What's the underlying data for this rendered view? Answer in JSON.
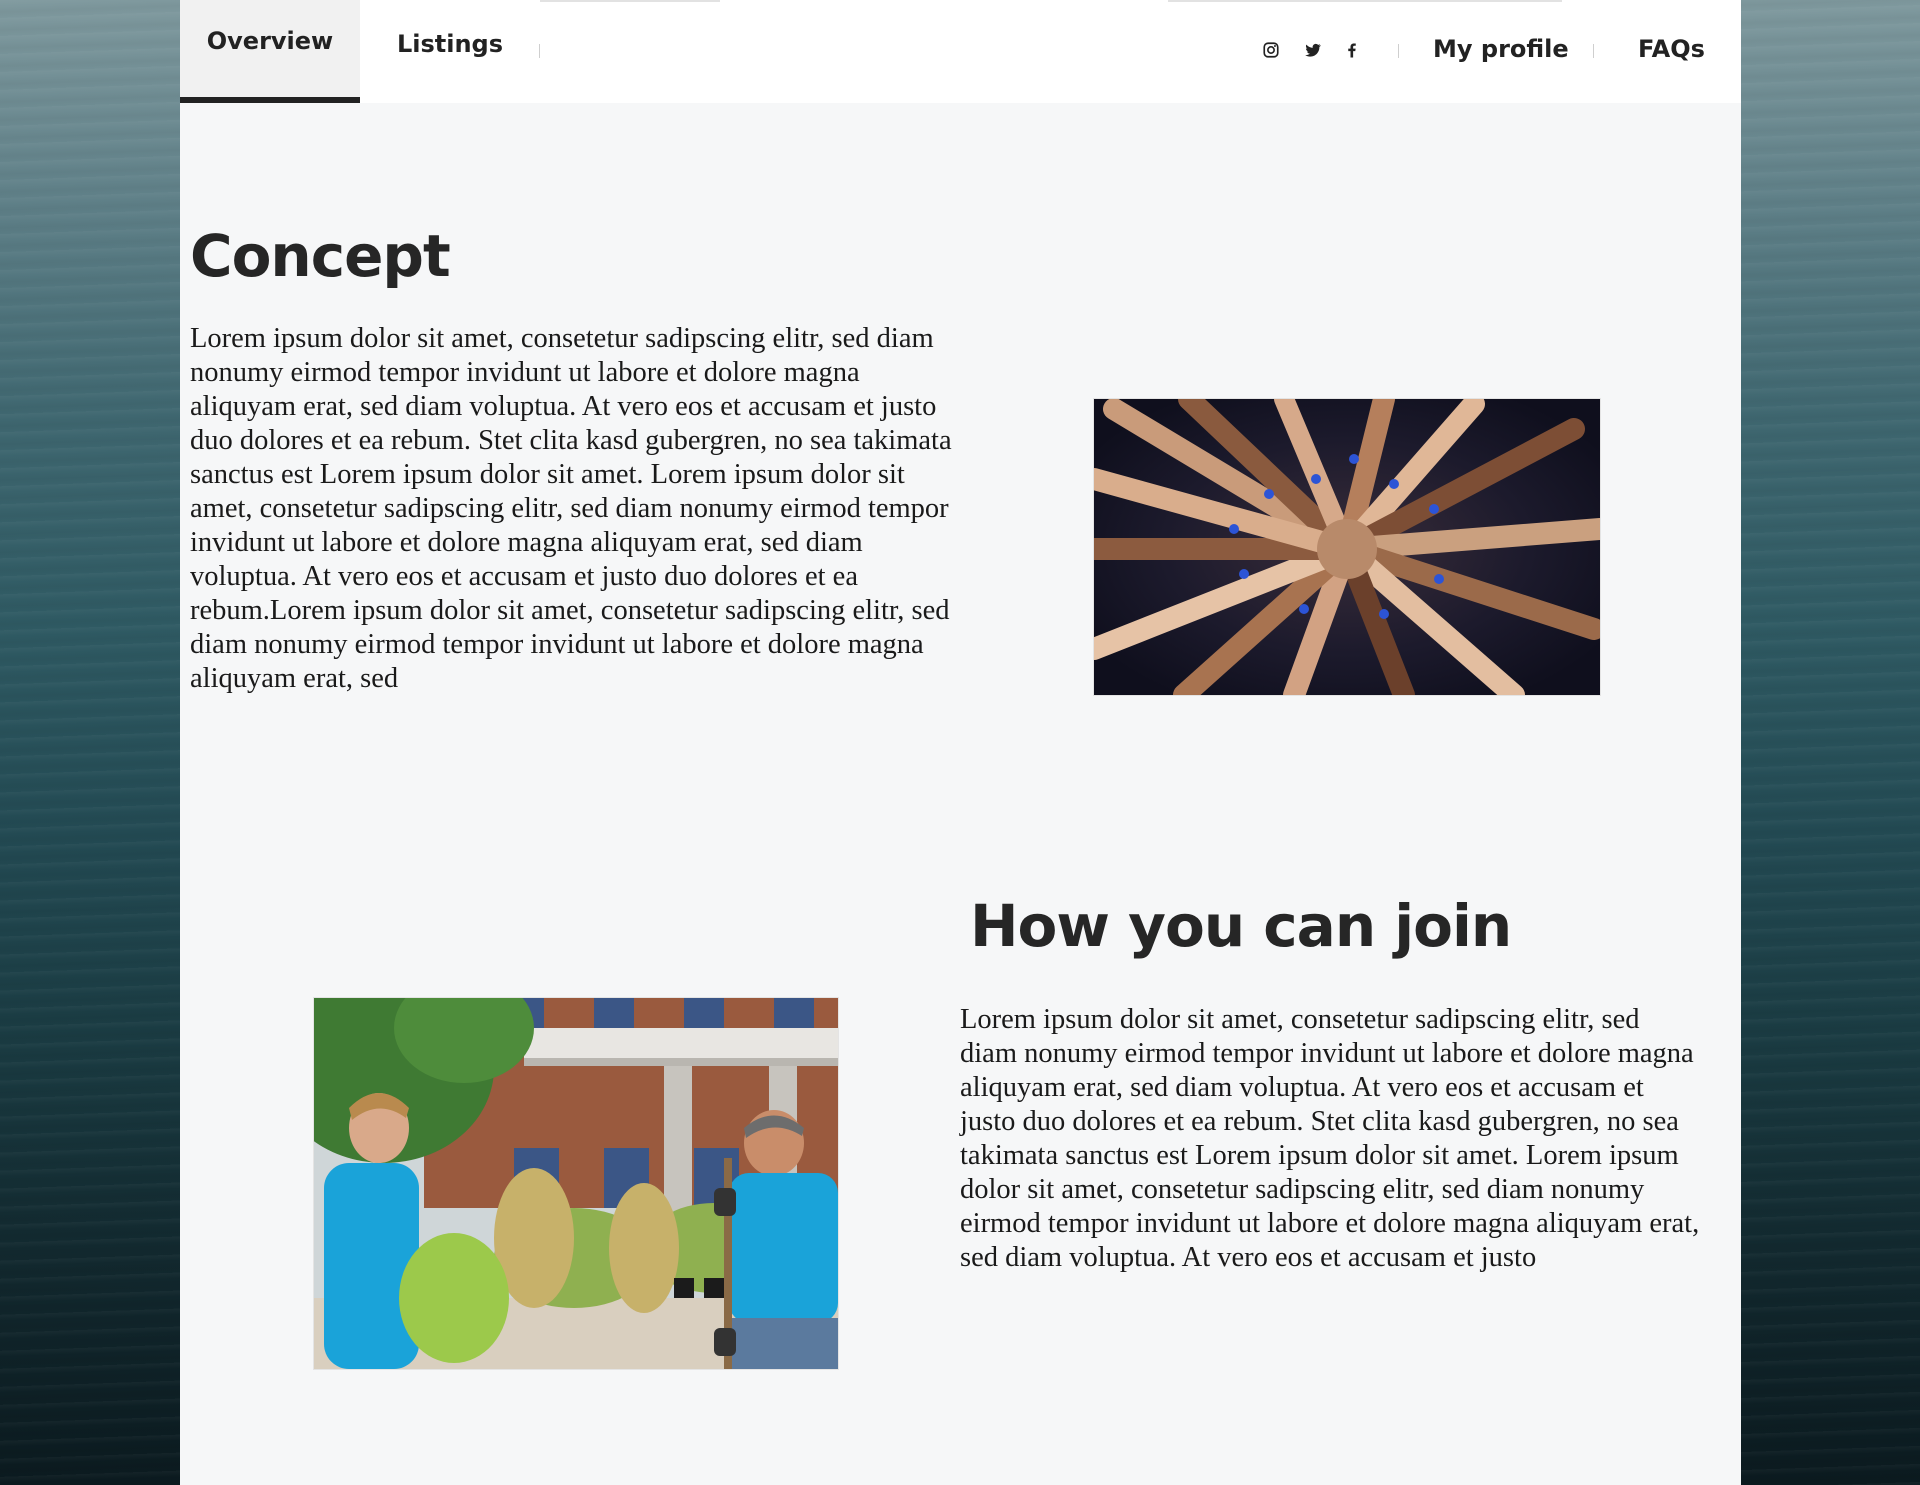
{
  "nav": {
    "tabs": [
      {
        "label": "Overview",
        "active": true
      },
      {
        "label": "Listings",
        "active": false
      }
    ],
    "social": [
      "instagram-icon",
      "twitter-icon",
      "facebook-icon"
    ],
    "links": [
      "My profile",
      "FAQs"
    ]
  },
  "concept": {
    "title": "Concept",
    "body": "Lorem ipsum dolor sit amet, consetetur sadipscing elitr, sed diam nonumy eirmod tempor invidunt ut labore et dolore magna aliquyam erat, sed diam voluptua. At vero eos et accusam et justo duo dolores et ea rebum. Stet clita kasd gubergren, no sea takimata sanctus est Lorem ipsum dolor sit amet. Lorem ipsum dolor sit amet, consetetur sadipscing elitr, sed diam nonumy eirmod tempor invidunt ut labore et dolore magna aliquyam erat, sed diam voluptua. At vero eos et accusam et justo duo dolores et ea rebum.Lorem ipsum dolor sit amet, consetetur sadipscing elitr, sed diam nonumy eirmod tempor invidunt ut labore et dolore magna aliquyam erat, sed"
  },
  "join": {
    "title": "How you can join",
    "body": "Lorem ipsum dolor sit amet, consetetur sadipscing elitr, sed diam nonumy eirmod tempor invidunt ut labore et dolore magna aliquyam erat, sed diam voluptua. At vero eos et accusam et justo duo dolores et ea rebum. Stet clita kasd gubergren, no sea takimata sanctus est Lorem ipsum dolor sit amet. Lorem ipsum dolor sit amet, consetetur sadipscing elitr, sed diam nonumy eirmod tempor invidunt ut labore et dolore magna aliquyam erat, sed diam voluptua. At vero eos et accusam et justo"
  },
  "colors": {
    "text": "#222222",
    "panel": "#f6f7f8",
    "volunteer_shirt": "#1aa3d9"
  }
}
